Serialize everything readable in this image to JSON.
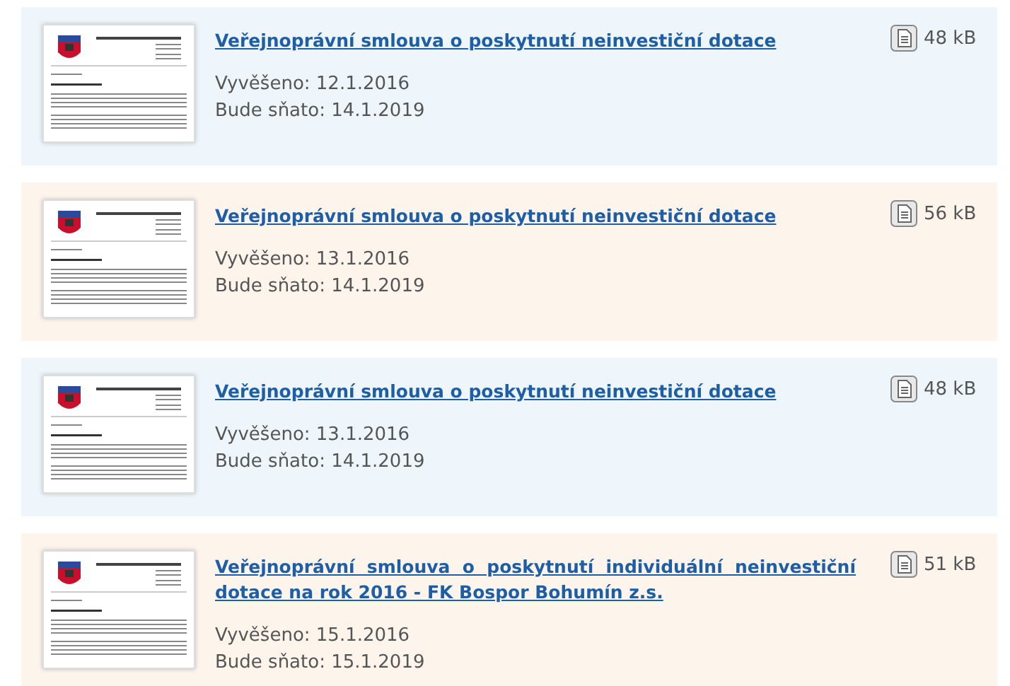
{
  "documents": [
    {
      "title": "Veřejnoprávní smlouva o poskytnutí neinvestiční dotace",
      "posted": "Vyvěšeno: 12.1.2016",
      "removed": "Bude sňato: 14.1.2019",
      "size": "48 kB"
    },
    {
      "title": "Veřejnoprávní smlouva o poskytnutí neinvestiční dotace",
      "posted": "Vyvěšeno: 13.1.2016",
      "removed": "Bude sňato: 14.1.2019",
      "size": "56 kB"
    },
    {
      "title": "Veřejnoprávní smlouva o poskytnutí neinvestiční dotace",
      "posted": "Vyvěšeno: 13.1.2016",
      "removed": "Bude sňato: 14.1.2019",
      "size": "48 kB"
    },
    {
      "title": "Veřejnoprávní smlouva o poskytnutí individuální neinvestiční dotace na rok 2016 - FK Bospor Bohumín z.s.",
      "posted": "Vyvěšeno: 15.1.2016",
      "removed": "Bude sňato: 15.1.2019",
      "size": "51 kB"
    }
  ]
}
